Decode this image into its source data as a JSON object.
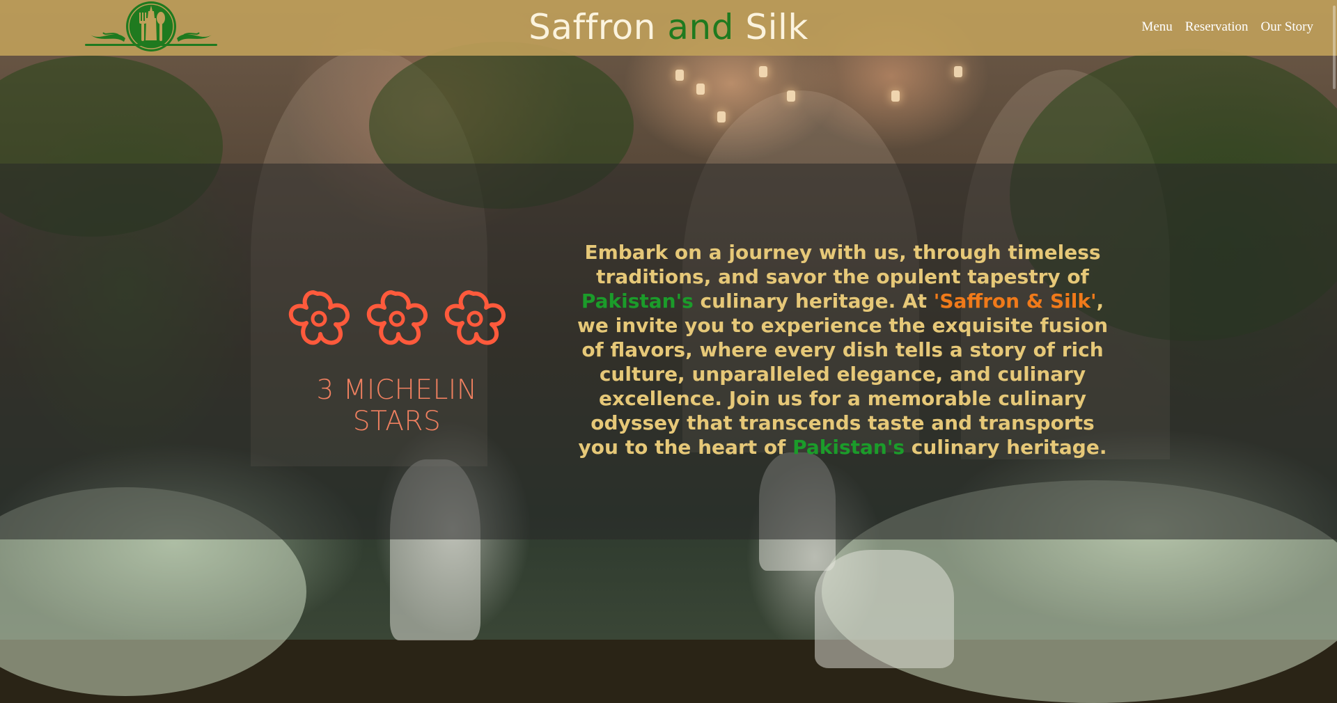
{
  "header": {
    "title_part1": "Saffron",
    "title_part2": "and",
    "title_part3": "Silk",
    "nav": [
      {
        "label": "Menu"
      },
      {
        "label": "Reservation"
      },
      {
        "label": "Our Story"
      }
    ]
  },
  "hero": {
    "michelin_caption": "3 MICHELIN STARS",
    "intro": [
      {
        "text": "Embark on a journey with us, through timeless traditions, and savor the opulent tapestry of ",
        "style": "plain"
      },
      {
        "text": "Pakistan's",
        "style": "green"
      },
      {
        "text": " culinary heritage. At ",
        "style": "plain"
      },
      {
        "text": "'Saffron & Silk'",
        "style": "orange"
      },
      {
        "text": ", we invite you to experience the exquisite fusion of flavors, where every dish tells a story of rich culture, unparalleled elegance, and culinary excellence. Join us for a memorable culinary odyssey that transcends taste and transports you to the heart of ",
        "style": "plain"
      },
      {
        "text": "Pakistan's",
        "style": "green"
      },
      {
        "text": " culinary heritage.",
        "style": "plain"
      }
    ]
  },
  "colors": {
    "header_bg": "#c0a05a",
    "title_accent": "#1f7a1f",
    "intro_text": "#e6c878",
    "highlight_green": "#1b9c2a",
    "highlight_orange": "#f07a1a",
    "michelin_stars": "#ff5a3c"
  },
  "icons": {
    "logo": "fork-minar-spoon-emblem",
    "michelin": "michelin-star-flower-icon"
  }
}
